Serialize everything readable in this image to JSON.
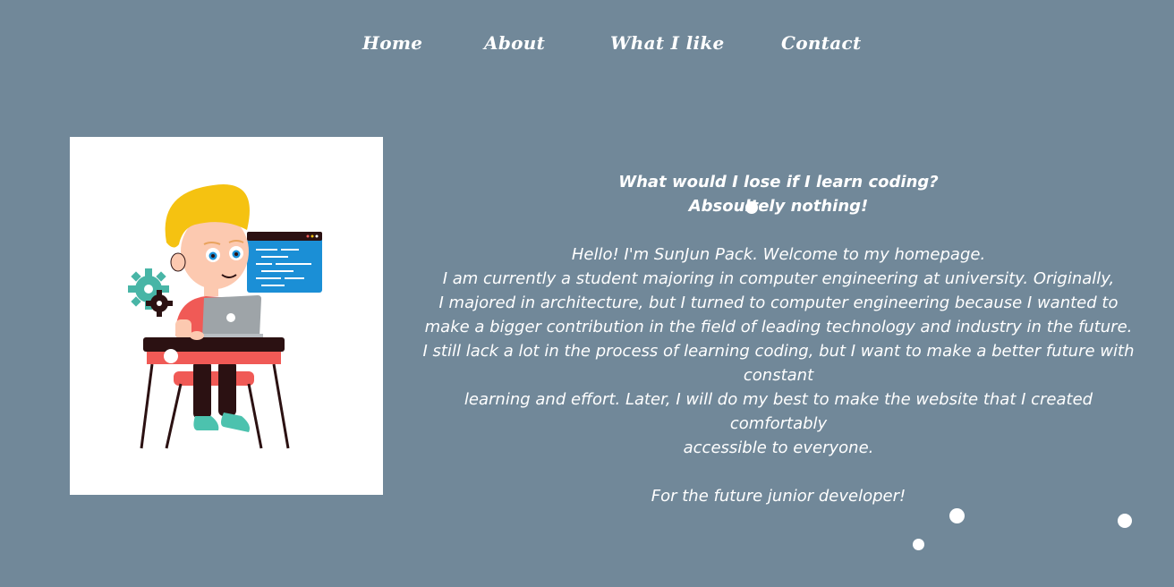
{
  "nav": {
    "home": "Home",
    "about": "About",
    "what_i_like": "What I like",
    "contact": "Contact"
  },
  "profile_image": {
    "icon": "boy-coding-illustration",
    "colors": {
      "hair": "#f5c211",
      "skin": "#fcc9b0",
      "shirt": "#f05a56",
      "desk": "#2b1112",
      "screen": "#1b8fd6",
      "gear": "#48b5a6",
      "shoes": "#4cc2ae"
    }
  },
  "intro": {
    "headline_line1": "What would I lose if I learn coding?",
    "headline_line2": "Absoultely nothing!",
    "lines": [
      "Hello! I'm SunJun Pack. Welcome to my homepage.",
      "I am currently a student majoring in computer engineering at university. Originally,",
      "I majored in architecture, but I turned to computer engineering because I wanted to",
      "make a bigger contribution in the field of leading technology and industry in the future.",
      "I still lack a lot in the process of learning coding, but I want to make a better future with",
      "constant",
      "learning and effort. Later, I will do my best to make the website that I created comfortably",
      "accessible to everyone."
    ],
    "signoff": "For the future junior developer!"
  },
  "theme": {
    "background": "#718899",
    "text": "#ffffff"
  }
}
